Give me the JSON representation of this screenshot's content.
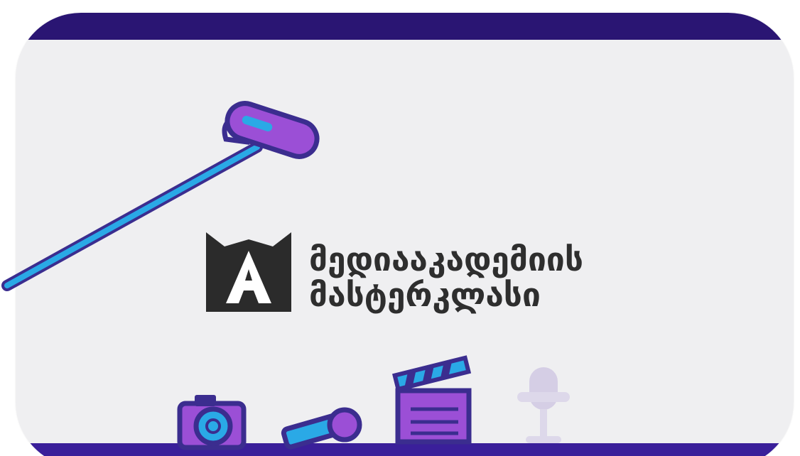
{
  "banner": {
    "brand_line_1": "მედიააკადემიის",
    "brand_line_2": "მასტერკლასი"
  },
  "logo": {
    "letter": "A",
    "icon": "media-academy-logo"
  },
  "illustrations": [
    {
      "icon": "boom-microphone-icon"
    },
    {
      "icon": "camera-icon"
    },
    {
      "icon": "handheld-microphone-icon"
    },
    {
      "icon": "clapperboard-icon"
    },
    {
      "icon": "studio-microphone-icon"
    }
  ],
  "colors": {
    "band_top": "#2a1573",
    "band_bottom": "#3a1f9a",
    "card_background": "#efeff1",
    "accent_purple": "#9b4fd6",
    "accent_blue": "#2aa9e6",
    "outline": "#3b2d8f",
    "logo_dark": "#2b2b2b",
    "text_dark": "#2e2e2e"
  }
}
